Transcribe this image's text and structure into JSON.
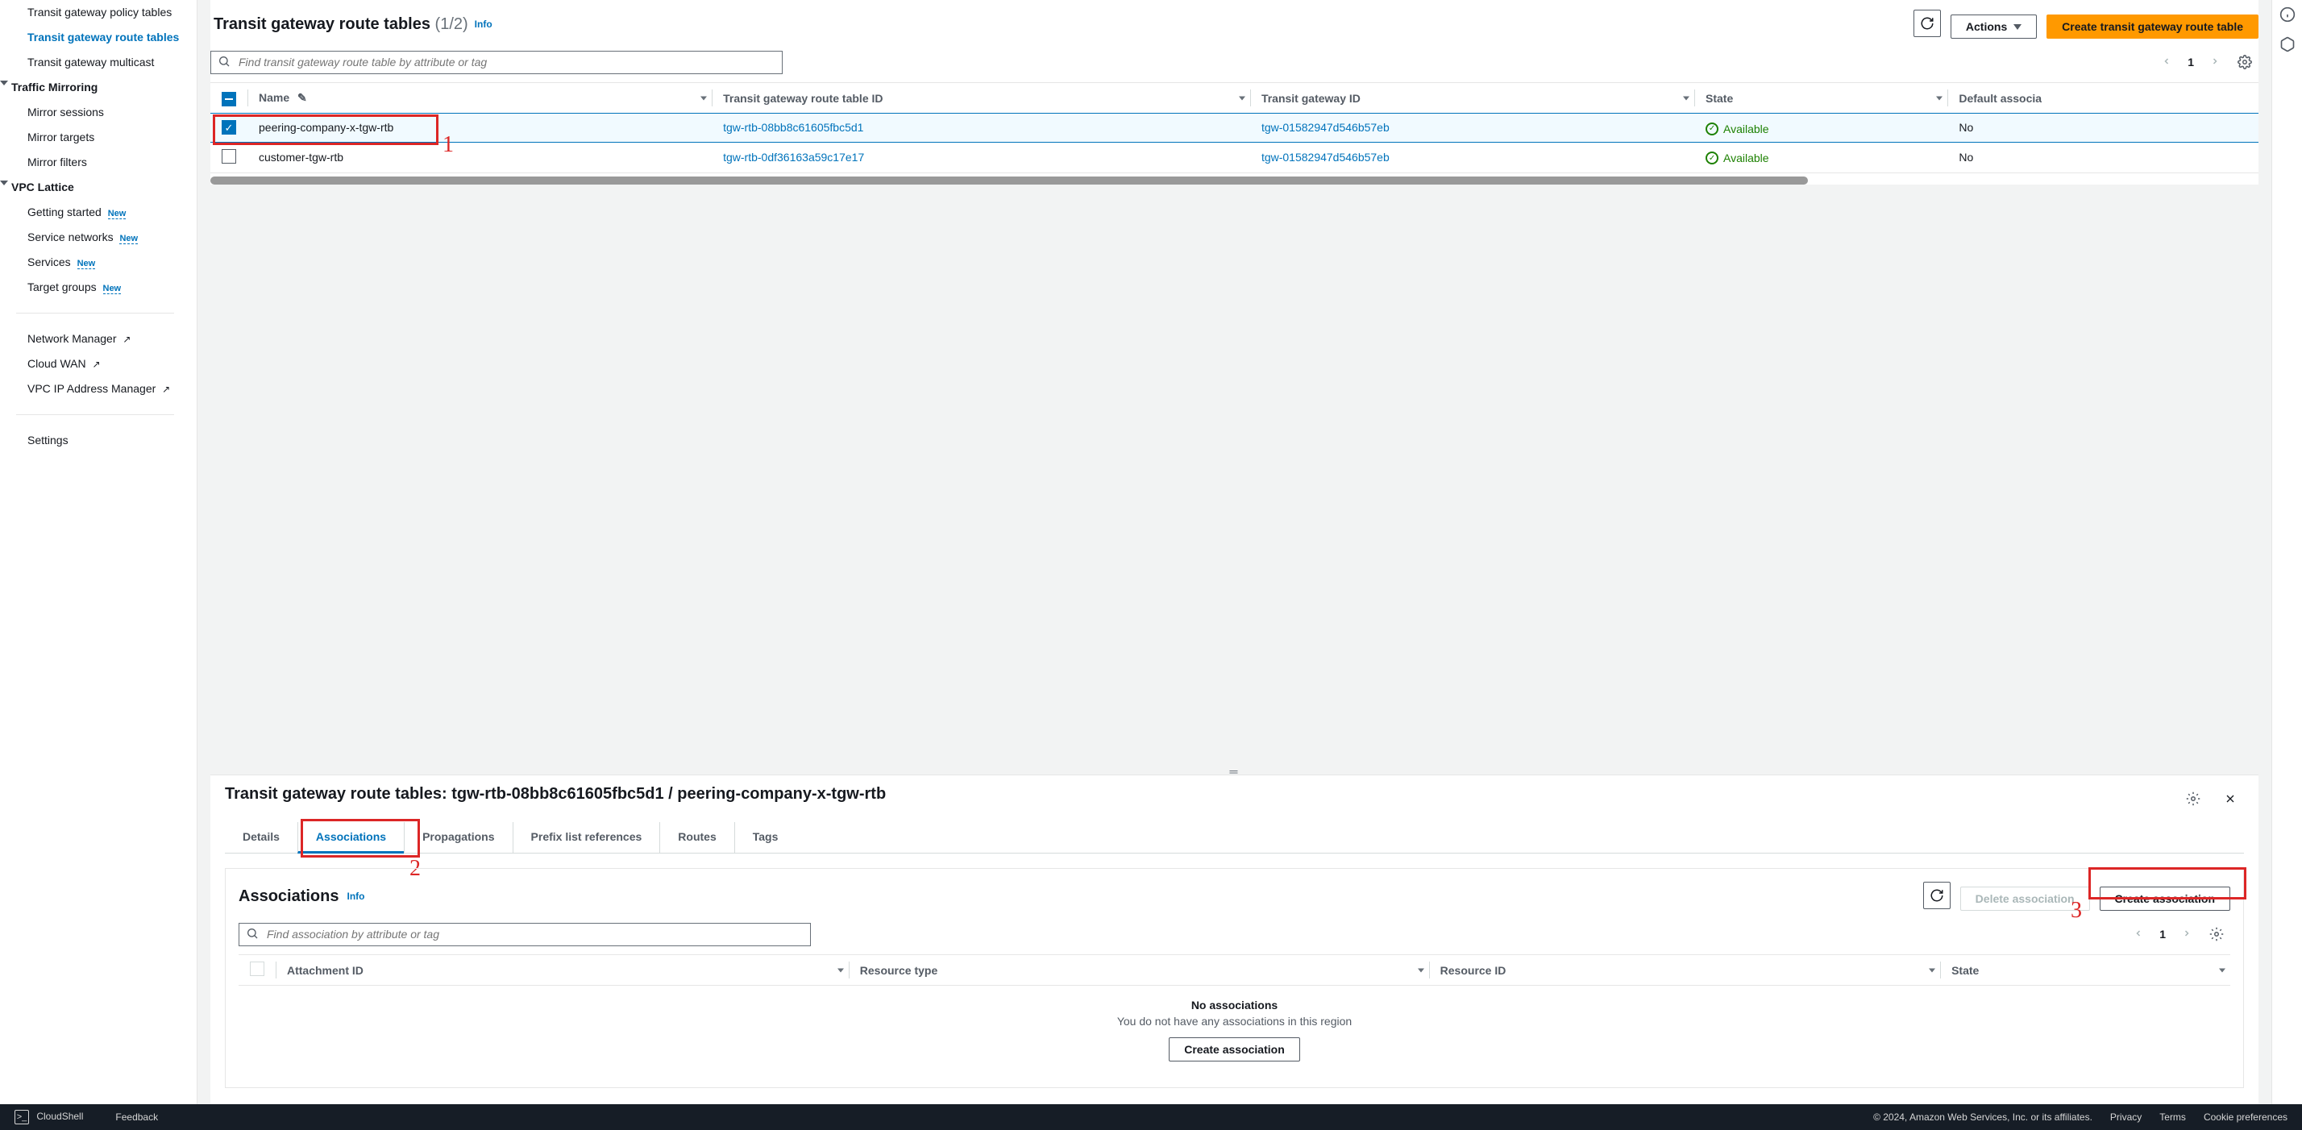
{
  "sidebar": {
    "items_top": [
      {
        "label": "Transit gateway policy tables",
        "active": false
      },
      {
        "label": "Transit gateway route tables",
        "active": true
      },
      {
        "label": "Transit gateway multicast",
        "active": false
      }
    ],
    "section_traffic_label": "Traffic Mirroring",
    "traffic_items": [
      {
        "label": "Mirror sessions"
      },
      {
        "label": "Mirror targets"
      },
      {
        "label": "Mirror filters"
      }
    ],
    "section_lattice_label": "VPC Lattice",
    "lattice_items": [
      {
        "label": "Getting started",
        "new": true
      },
      {
        "label": "Service networks",
        "new": true
      },
      {
        "label": "Services",
        "new": true
      },
      {
        "label": "Target groups",
        "new": true
      }
    ],
    "external_items": [
      {
        "label": "Network Manager"
      },
      {
        "label": "Cloud WAN"
      },
      {
        "label": "VPC IP Address Manager"
      }
    ],
    "settings_label": "Settings"
  },
  "panel": {
    "title": "Transit gateway route tables",
    "count": "(1/2)",
    "info_label": "Info",
    "refresh_label": "Refresh",
    "actions_label": "Actions",
    "create_label": "Create transit gateway route table",
    "search_placeholder": "Find transit gateway route table by attribute or tag",
    "page_label": "1",
    "columns": {
      "name": "Name",
      "rtb_id": "Transit gateway route table ID",
      "tgw_id": "Transit gateway ID",
      "state": "State",
      "default_assoc": "Default associa"
    },
    "rows": [
      {
        "selected": true,
        "name": "peering-company-x-tgw-rtb",
        "rtb_id": "tgw-rtb-08bb8c61605fbc5d1",
        "tgw_id": "tgw-01582947d546b57eb",
        "state": "Available",
        "default_assoc": "No"
      },
      {
        "selected": false,
        "name": "customer-tgw-rtb",
        "rtb_id": "tgw-rtb-0df36163a59c17e17",
        "tgw_id": "tgw-01582947d546b57eb",
        "state": "Available",
        "default_assoc": "No"
      }
    ]
  },
  "detail": {
    "title_prefix": "Transit gateway route tables: ",
    "title_id": "tgw-rtb-08bb8c61605fbc5d1 / peering-company-x-tgw-rtb",
    "tabs": [
      {
        "label": "Details",
        "active": false
      },
      {
        "label": "Associations",
        "active": true
      },
      {
        "label": "Propagations",
        "active": false
      },
      {
        "label": "Prefix list references",
        "active": false
      },
      {
        "label": "Routes",
        "active": false
      },
      {
        "label": "Tags",
        "active": false
      }
    ],
    "assoc": {
      "title": "Associations",
      "info_label": "Info",
      "delete_label": "Delete association",
      "create_label": "Create association",
      "search_placeholder": "Find association by attribute or tag",
      "page_label": "1",
      "columns": {
        "attachment_id": "Attachment ID",
        "resource_type": "Resource type",
        "resource_id": "Resource ID",
        "state": "State"
      },
      "empty_title": "No associations",
      "empty_sub": "You do not have any associations in this region",
      "empty_cta": "Create association"
    }
  },
  "annotations": {
    "n1": "1",
    "n2": "2",
    "n3": "3"
  },
  "footer": {
    "cloudshell": "CloudShell",
    "feedback": "Feedback",
    "copyright": "© 2024, Amazon Web Services, Inc. or its affiliates.",
    "links": [
      {
        "label": "Privacy"
      },
      {
        "label": "Terms"
      },
      {
        "label": "Cookie preferences"
      }
    ]
  },
  "new_badge": "New"
}
